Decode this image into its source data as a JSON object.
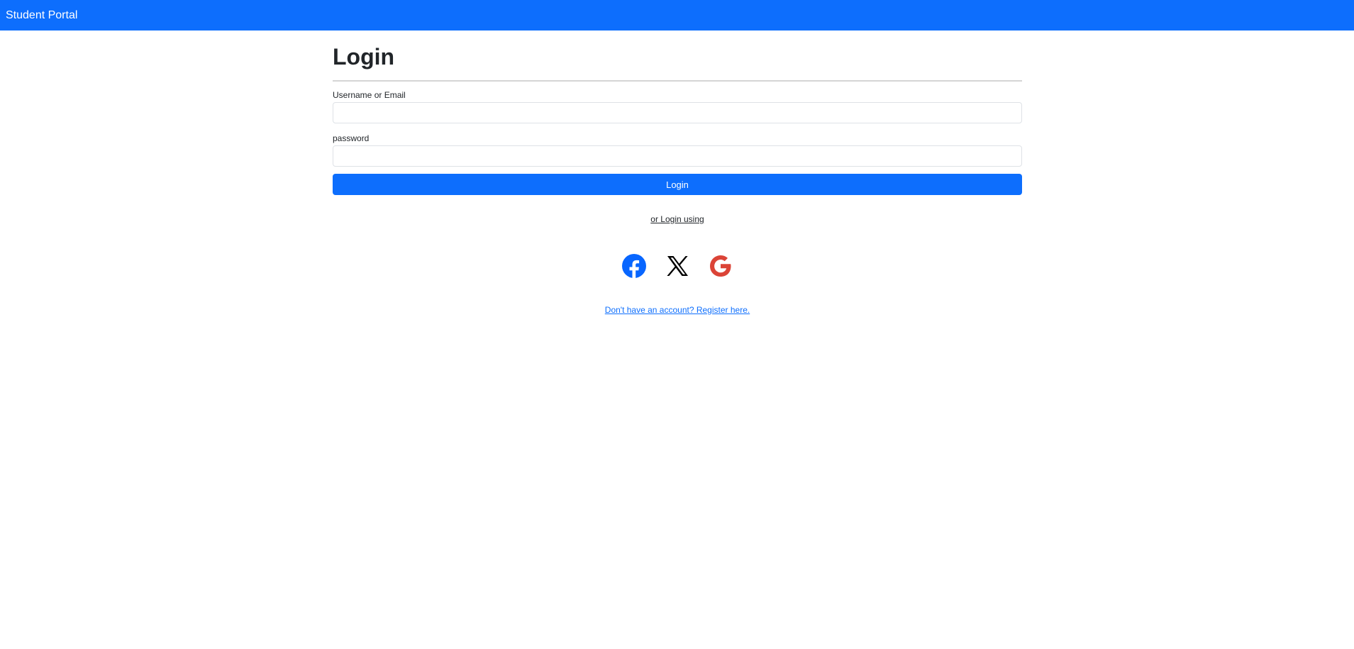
{
  "navbar": {
    "brand": "Student Portal",
    "color": "#0d6efd"
  },
  "login_form": {
    "title": "Login",
    "username_label": "Username or Email",
    "username_value": "",
    "password_label": "password",
    "password_value": "",
    "submit_label": "Login"
  },
  "social": {
    "prompt": "or Login using",
    "providers": [
      {
        "name": "Facebook",
        "icon": "facebook-icon",
        "color": "#0866ff"
      },
      {
        "name": "X",
        "icon": "x-icon",
        "color": "#000000"
      },
      {
        "name": "Google",
        "icon": "google-icon",
        "color": "#db4437"
      }
    ]
  },
  "register": {
    "link_text": "Don't have an account? Register here."
  }
}
